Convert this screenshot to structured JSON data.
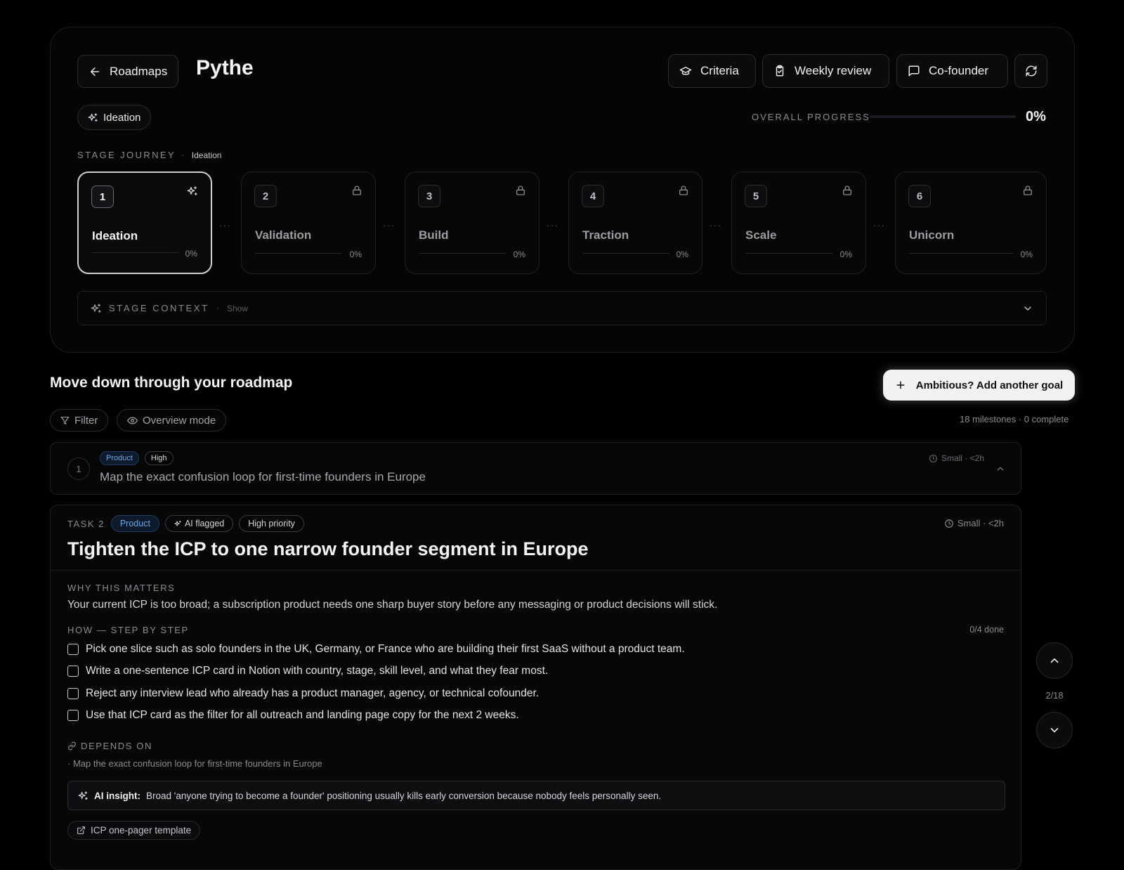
{
  "header": {
    "back_label": "Roadmaps",
    "title": "Pythe",
    "actions": [
      {
        "label": "Criteria",
        "icon": "graduation-cap-icon"
      },
      {
        "label": "Weekly review",
        "icon": "clipboard-check-icon"
      },
      {
        "label": "Co-founder",
        "icon": "message-square-icon"
      }
    ],
    "refresh_icon": "refresh-icon",
    "stage_badge": "Ideation",
    "progress_label": "OVERALL PROGRESS",
    "progress_value": "0%",
    "progress_fraction": 0
  },
  "journey": {
    "label": "STAGE JOURNEY",
    "current": "Ideation",
    "stages": [
      {
        "number": "1",
        "name": "Ideation",
        "percent": "0%",
        "state": "active"
      },
      {
        "number": "2",
        "name": "Validation",
        "percent": "0%",
        "state": "locked"
      },
      {
        "number": "3",
        "name": "Build",
        "percent": "0%",
        "state": "locked"
      },
      {
        "number": "4",
        "name": "Traction",
        "percent": "0%",
        "state": "locked"
      },
      {
        "number": "5",
        "name": "Scale",
        "percent": "0%",
        "state": "locked"
      },
      {
        "number": "6",
        "name": "Unicorn",
        "percent": "0%",
        "state": "locked"
      }
    ],
    "separator": "···"
  },
  "context": {
    "label": "STAGE CONTEXT",
    "toggle": "Show"
  },
  "roadmap": {
    "title": "Move down through your roadmap",
    "add_goal": "Ambitious? Add another goal",
    "filter": "Filter",
    "overview": "Overview mode",
    "count": "18 milestones · 0 complete"
  },
  "milestone1": {
    "number": "1",
    "tags": [
      "Product",
      "High"
    ],
    "title": "Map the exact confusion loop for first-time founders in Europe",
    "meta": "Small · <2h"
  },
  "task": {
    "label": "TASK 2",
    "tags": [
      "Product",
      "AI flagged",
      "High priority"
    ],
    "meta": "Small · <2h",
    "title": "Tighten the ICP to one narrow founder segment in Europe",
    "why_label": "WHY THIS MATTERS",
    "why_text": "Your current ICP is too broad; a subscription product needs one sharp buyer story before any messaging or product decisions will stick.",
    "how_label": "HOW — STEP BY STEP",
    "done": "0/4 done",
    "steps": [
      "Pick one slice such as solo founders in the UK, Germany, or France who are building their first SaaS without a product team.",
      "Write a one-sentence ICP card in Notion with country, stage, skill level, and what they fear most.",
      "Reject any interview lead who already has a product manager, agency, or technical cofounder.",
      "Use that ICP card as the filter for all outreach and landing page copy for the next 2 weeks."
    ],
    "depends_label": "DEPENDS ON",
    "depends_item": "· Map the exact confusion loop for first-time founders in Europe",
    "insight_label": "AI insight:",
    "insight_text": "Broad 'anyone trying to become a founder' positioning usually kills early conversion because nobody feels personally seen.",
    "resource": "ICP one-pager template"
  },
  "pager": {
    "position": "2/18"
  },
  "colors": {
    "accent_blue": "#6ea8e8",
    "background": "#000000",
    "button_light": "#f2f2f4"
  }
}
